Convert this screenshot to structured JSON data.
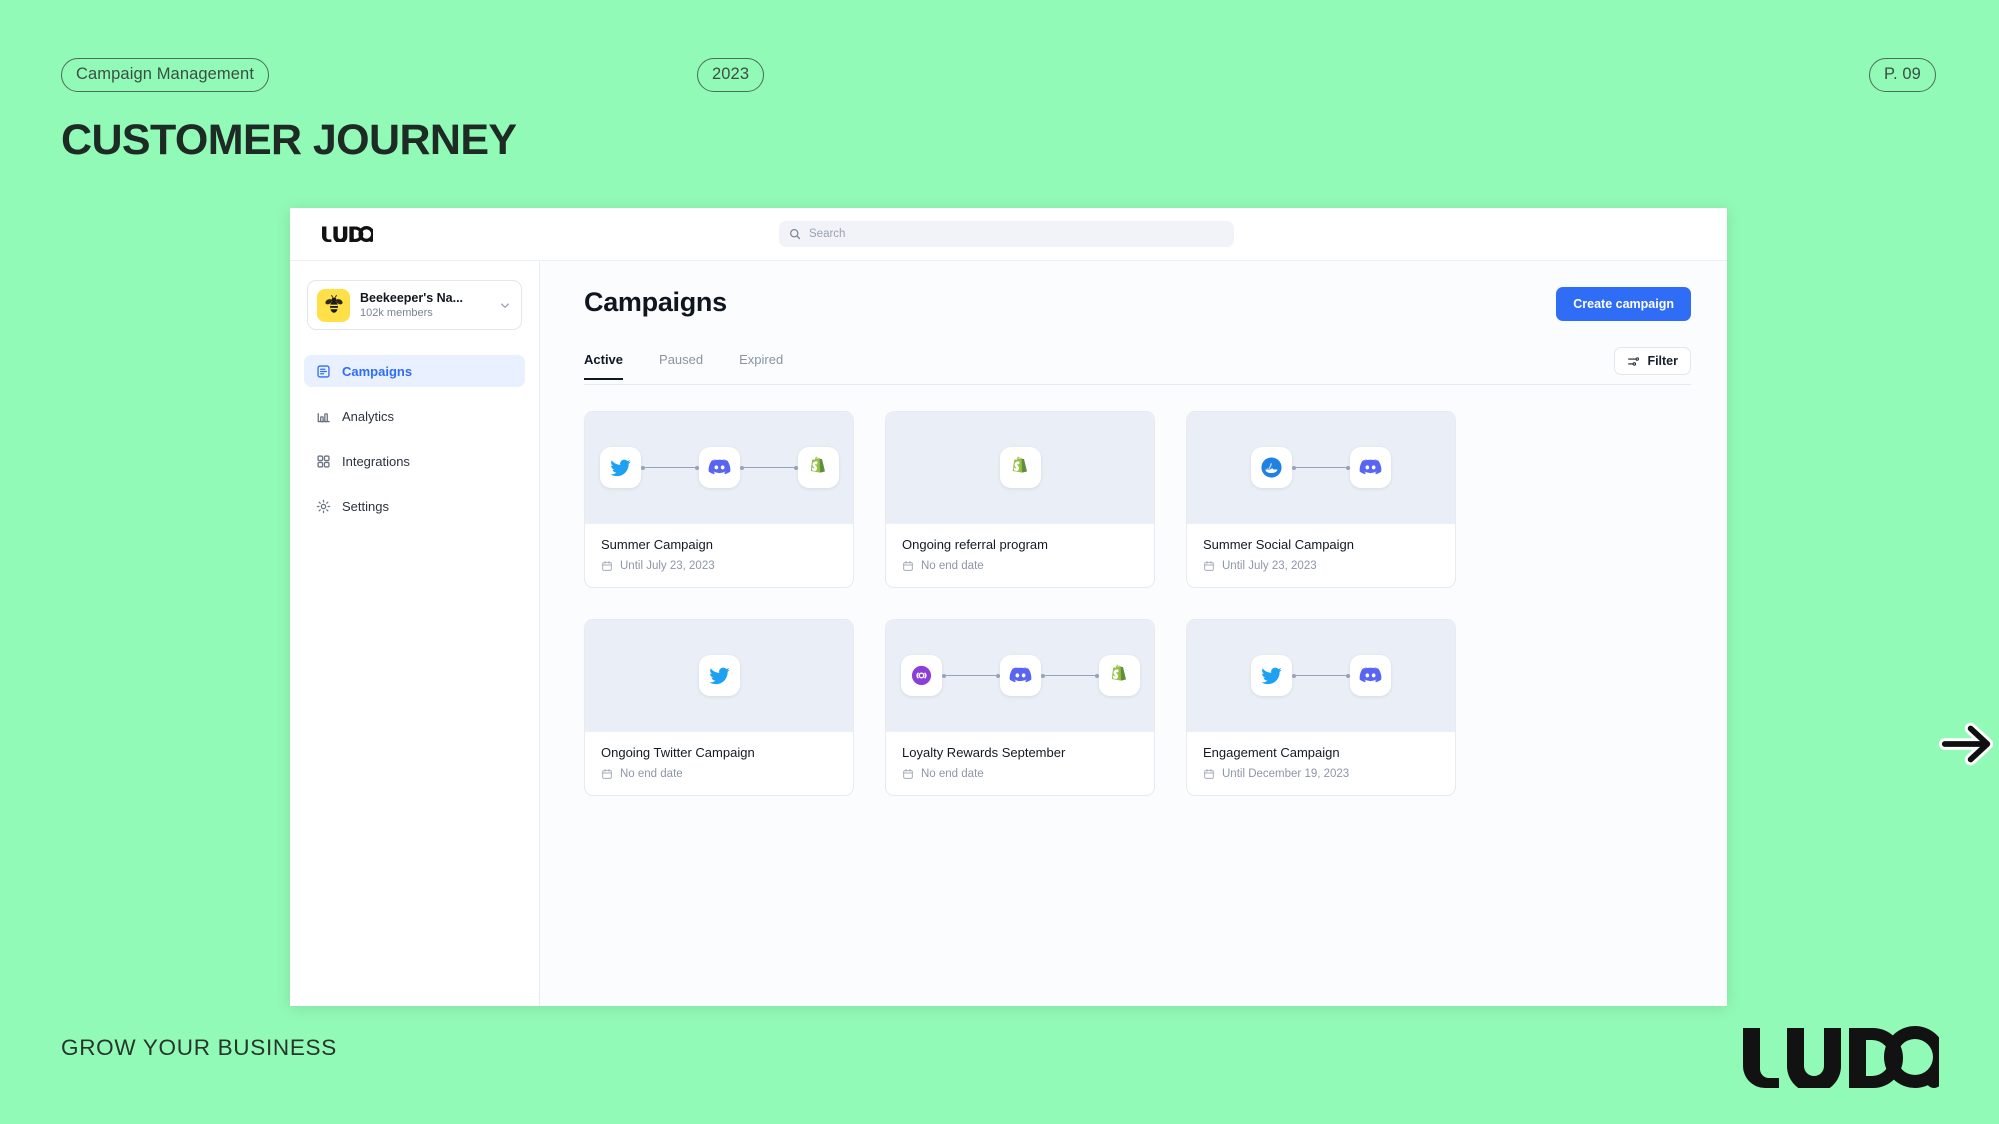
{
  "slide": {
    "topic_tag": "Campaign Management",
    "year_tag": "2023",
    "page_tag": "P. 09",
    "title": "CUSTOMER JOURNEY",
    "footer": "GROW YOUR BUSINESS",
    "brand": "LUDO.",
    "background_color": "#92FAB7",
    "next_arrow_icon": "arrow-right-icon"
  },
  "app": {
    "logo_text": "LUDO.",
    "search": {
      "placeholder": "Search",
      "icon": "search-icon"
    },
    "workspace": {
      "name": "Beekeeper's Na...",
      "members": "102k members",
      "avatar_icon": "bee-icon",
      "avatar_color": "#FFE047",
      "chevron_icon": "chevron-down-icon"
    },
    "sidebar": {
      "items": [
        {
          "label": "Campaigns",
          "icon": "campaigns-icon",
          "active": true
        },
        {
          "label": "Analytics",
          "icon": "analytics-icon",
          "active": false
        },
        {
          "label": "Integrations",
          "icon": "integrations-icon",
          "active": false
        },
        {
          "label": "Settings",
          "icon": "settings-gear-icon",
          "active": false
        }
      ]
    },
    "main": {
      "page_title": "Campaigns",
      "create_button": "Create campaign",
      "create_button_color": "#2F6DF6",
      "filter_button": "Filter",
      "filter_icon": "sliders-icon",
      "tabs": [
        {
          "label": "Active",
          "active": true
        },
        {
          "label": "Paused",
          "active": false
        },
        {
          "label": "Expired",
          "active": false
        }
      ],
      "campaigns": [
        {
          "title": "Summer Campaign",
          "date": "Until July 23, 2023",
          "date_icon": "calendar-icon",
          "apps": [
            "twitter",
            "discord",
            "shopify"
          ]
        },
        {
          "title": "Ongoing referral program",
          "date": "No end date",
          "date_icon": "calendar-icon",
          "apps": [
            "shopify"
          ]
        },
        {
          "title": "Summer Social Campaign",
          "date": "Until July 23, 2023",
          "date_icon": "calendar-icon",
          "apps": [
            "opensea",
            "discord"
          ]
        },
        {
          "title": "Ongoing Twitter Campaign",
          "date": "No end date",
          "date_icon": "calendar-icon",
          "apps": [
            "twitter"
          ]
        },
        {
          "title": "Loyalty Rewards September",
          "date": "No end date",
          "date_icon": "calendar-icon",
          "apps": [
            "loyalty",
            "discord",
            "shopify"
          ]
        },
        {
          "title": "Engagement Campaign",
          "date": "Until December 19, 2023",
          "date_icon": "calendar-icon",
          "apps": [
            "twitter",
            "discord"
          ]
        }
      ]
    }
  },
  "cursor": {
    "icon": "mouse-pointer-icon"
  }
}
